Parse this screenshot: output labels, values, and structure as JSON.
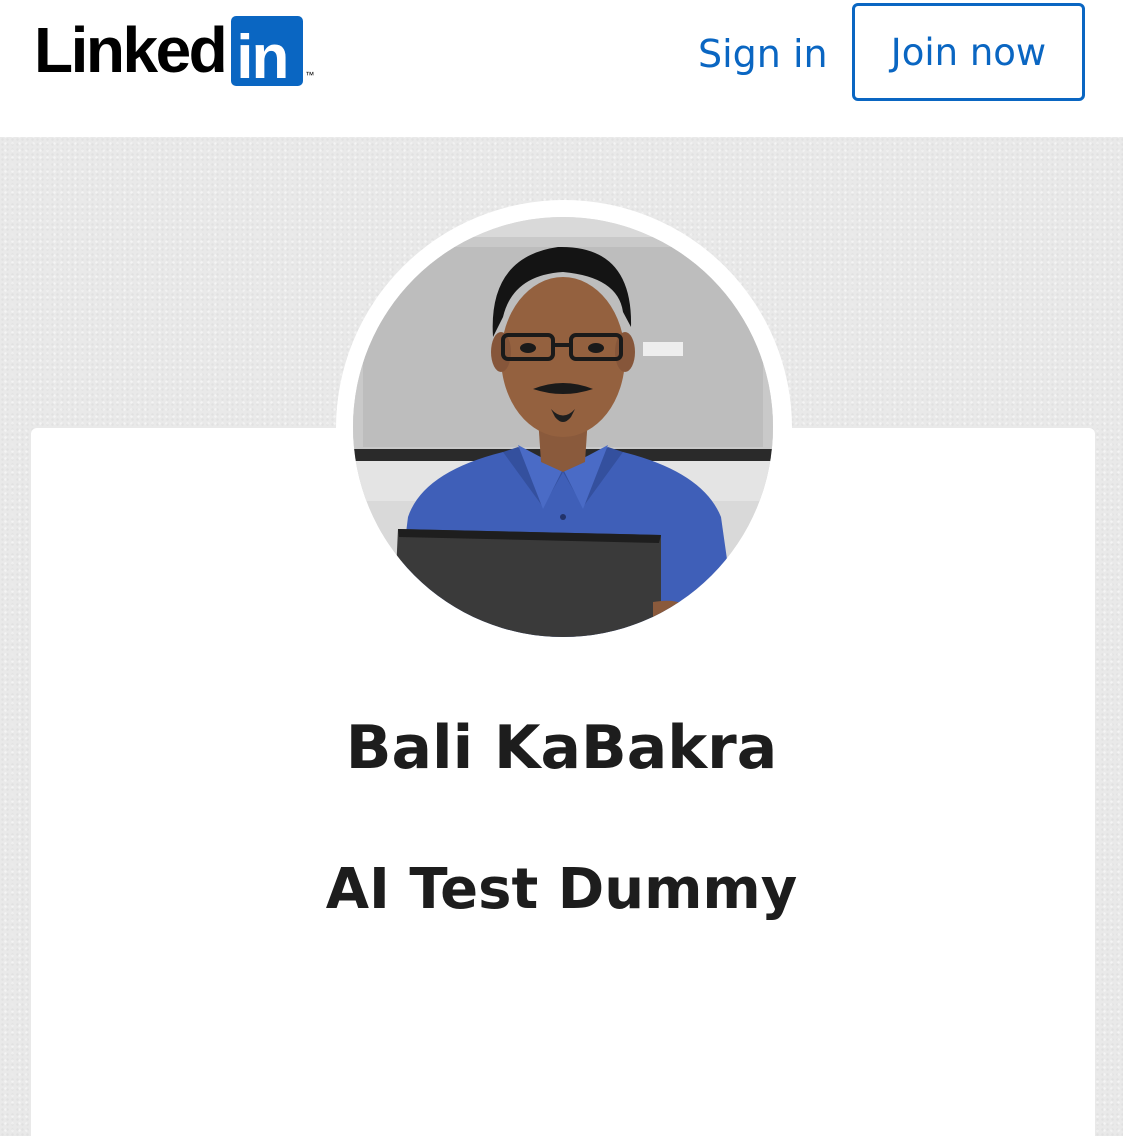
{
  "header": {
    "logo": {
      "word": "Linked",
      "box_text": "in",
      "trademark": "™",
      "brand_color": "#0a66c2"
    },
    "sign_in_label": "Sign in",
    "join_now_label": "Join now"
  },
  "profile": {
    "name": "Bali KaBakra",
    "headline": "AI Test Dummy",
    "avatar_icon": "profile-photo"
  }
}
